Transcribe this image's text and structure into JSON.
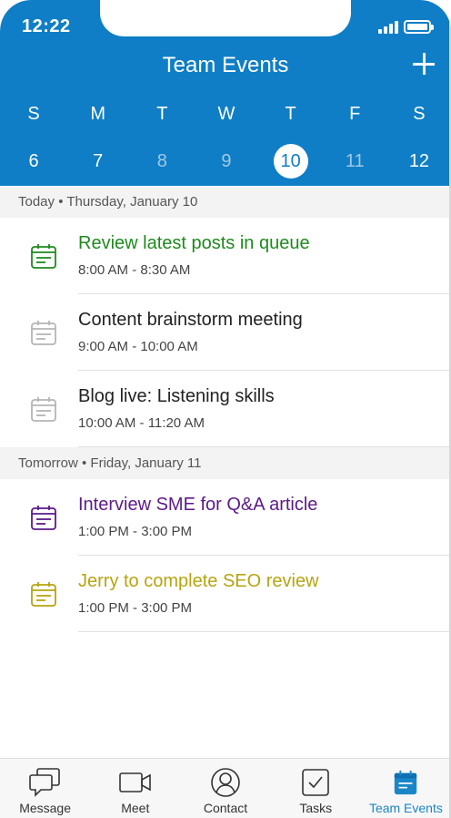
{
  "status_bar": {
    "time": "12:22"
  },
  "header": {
    "title": "Team Events",
    "add_icon": "plus-icon"
  },
  "week": [
    {
      "letter": "S",
      "number": "6",
      "state": "normal"
    },
    {
      "letter": "M",
      "number": "7",
      "state": "normal"
    },
    {
      "letter": "T",
      "number": "8",
      "state": "muted"
    },
    {
      "letter": "W",
      "number": "9",
      "state": "muted"
    },
    {
      "letter": "T",
      "number": "10",
      "state": "selected"
    },
    {
      "letter": "F",
      "number": "11",
      "state": "muted"
    },
    {
      "letter": "S",
      "number": "12",
      "state": "normal"
    }
  ],
  "sections": [
    {
      "heading": "Today • Thursday, January 10",
      "events": [
        {
          "title": "Review latest posts in queue",
          "time": "8:00 AM - 8:30 AM",
          "color": "#1e8a1e",
          "icon": "calendar-icon"
        },
        {
          "title": "Content brainstorm meeting",
          "time": "9:00 AM - 10:00 AM",
          "color": "#b5b5b5",
          "icon": "calendar-icon"
        },
        {
          "title": "Blog live: Listening skills",
          "time": "10:00 AM - 11:20 AM",
          "color": "#b5b5b5",
          "icon": "calendar-icon"
        }
      ]
    },
    {
      "heading": "Tomorrow • Friday, January 11",
      "events": [
        {
          "title": "Interview SME for Q&A article",
          "time": "1:00 PM - 3:00 PM",
          "color": "#5c1a8a",
          "icon": "calendar-icon"
        },
        {
          "title": "Jerry to complete SEO review",
          "time": "1:00 PM - 3:00 PM",
          "color": "#b7a410",
          "icon": "calendar-icon"
        }
      ]
    }
  ],
  "colors": {
    "header_bg": "#0f7ec6",
    "active_tab": "#1a86c8",
    "title_dark": "#222222"
  },
  "tabs": [
    {
      "label": "Message",
      "icon": "message-icon",
      "active": false
    },
    {
      "label": "Meet",
      "icon": "video-camera-icon",
      "active": false
    },
    {
      "label": "Contact",
      "icon": "person-icon",
      "active": false
    },
    {
      "label": "Tasks",
      "icon": "checkbox-icon",
      "active": false
    },
    {
      "label": "Team Events",
      "icon": "calendar-icon",
      "active": true
    }
  ]
}
